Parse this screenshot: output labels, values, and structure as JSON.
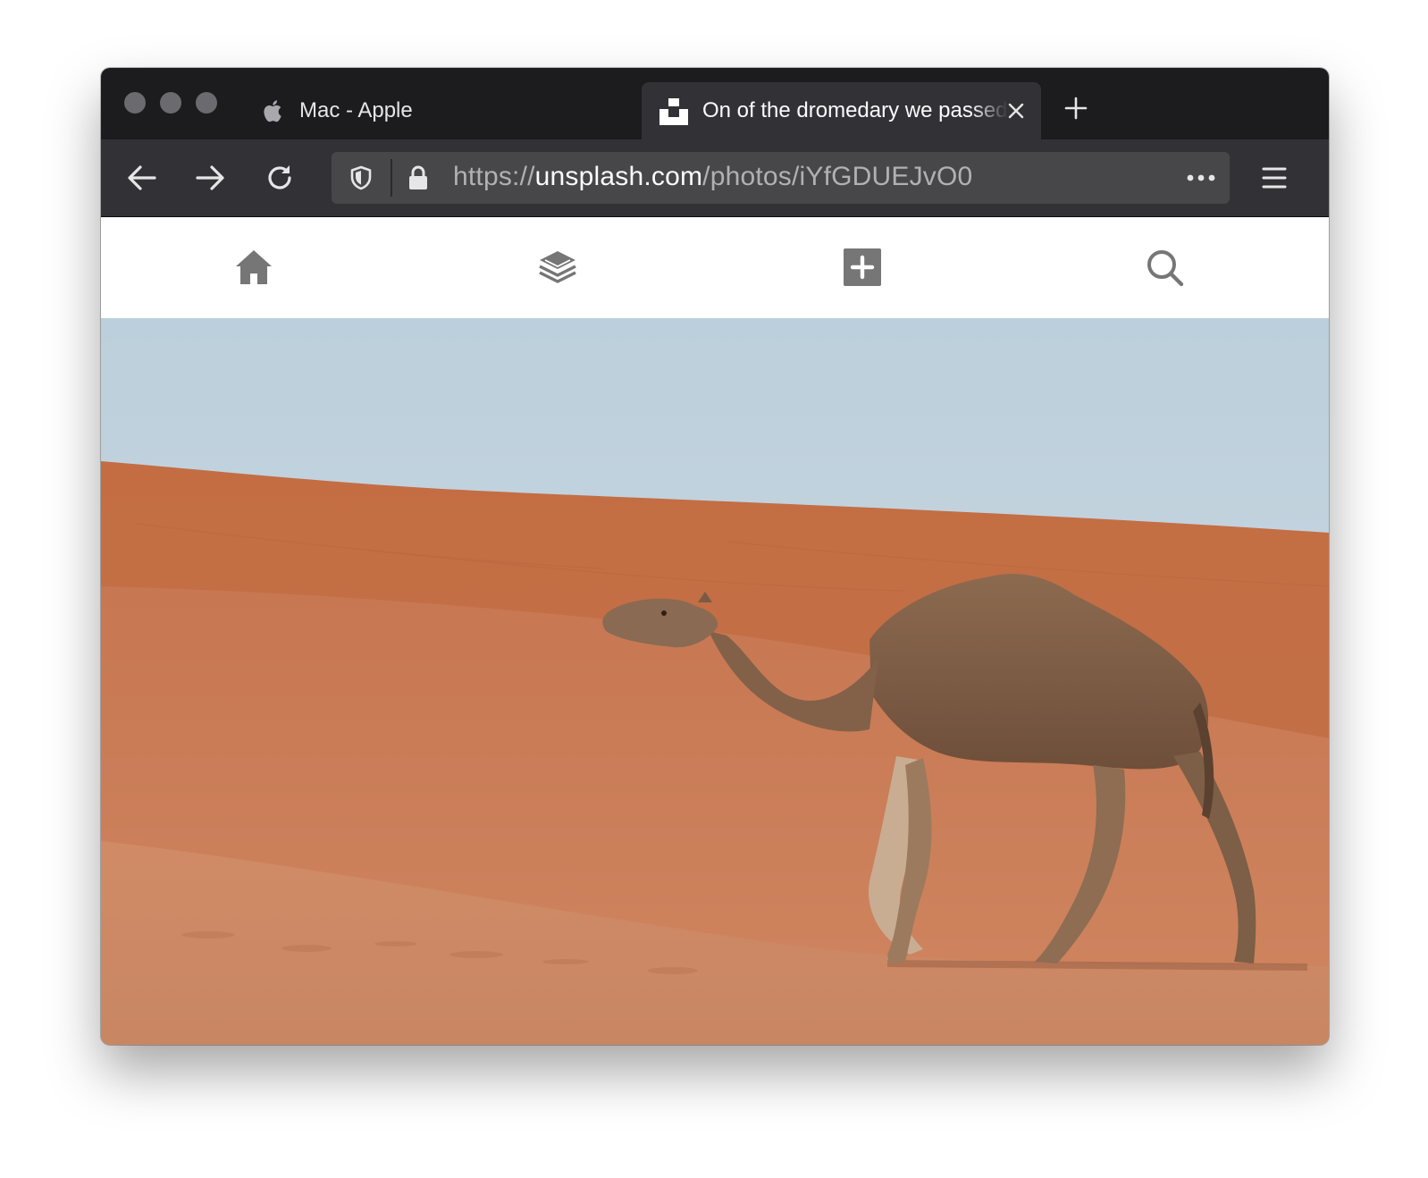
{
  "browser": {
    "tabs": [
      {
        "label": "Mac - Apple",
        "favicon": "apple-icon"
      },
      {
        "label": "On of the dromedary we passed",
        "favicon": "unsplash-icon",
        "active": true
      }
    ],
    "url": {
      "scheme": "https://",
      "host": "unsplash.com",
      "path": "/photos/iYfGDUEJvO0"
    }
  },
  "page_nav": {
    "items": [
      "home-icon",
      "collections-icon",
      "add-icon",
      "search-icon"
    ]
  },
  "photo": {
    "subject": "dromedary-camel",
    "colors": {
      "sky": "#c7d6e0",
      "sand": "#c97a4e",
      "camel": "#8a6448"
    }
  }
}
